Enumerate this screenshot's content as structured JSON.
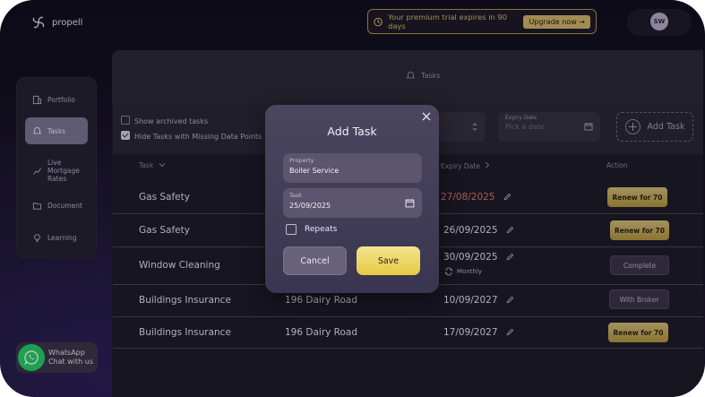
{
  "brand": {
    "name": "propell"
  },
  "trial": {
    "message": "Your premium trial expires in 90 days",
    "cta": "Upgrade now",
    "cta_arrow": "→"
  },
  "user": {
    "initials": "SW"
  },
  "sidebar": {
    "items": [
      {
        "label": "Portfolio",
        "icon": "portfolio-icon",
        "active": false
      },
      {
        "label": "Tasks",
        "icon": "tasks-icon",
        "active": true
      },
      {
        "label": "Live Mortgage Rates",
        "line1": "Live",
        "line2": "Mortgage",
        "line3": "Rates",
        "icon": "chart-icon",
        "active": false
      },
      {
        "label": "Document",
        "icon": "folder-icon",
        "active": false
      },
      {
        "label": "Learning",
        "icon": "lightbulb-icon",
        "active": false
      }
    ]
  },
  "page": {
    "title": "Tasks"
  },
  "filters": {
    "show_archived": "Show archived tasks",
    "hide_missing": "Hide Tasks with Missing Data Points",
    "expiry_label": "Expiry Date",
    "expiry_placeholder": "Pick a date",
    "add_task": "Add Task"
  },
  "table": {
    "headers": {
      "task": "Task",
      "expiry": "Expiry Date",
      "action": "Action"
    },
    "rows": [
      {
        "task": "Gas Safety",
        "property": "",
        "expiry": "27/08/2025",
        "overdue": true,
        "sub": "",
        "action": "Renew for 70",
        "action_style": "gold"
      },
      {
        "task": "Gas Safety",
        "property": "",
        "expiry": "26/09/2025",
        "overdue": false,
        "sub": "",
        "action": "Renew for 70",
        "action_style": "gold"
      },
      {
        "task": "Window Cleaning",
        "property": "",
        "expiry": "30/09/2025",
        "overdue": false,
        "sub": "Monthly",
        "action": "Complete",
        "action_style": "dark"
      },
      {
        "task": "Buildings Insurance",
        "property": "196 Dairy Road",
        "expiry": "10/09/2027",
        "overdue": false,
        "sub": "",
        "action": "With Broker",
        "action_style": "dark"
      },
      {
        "task": "Buildings Insurance",
        "property": "196 Dairy Road",
        "expiry": "17/09/2027",
        "overdue": false,
        "sub": "",
        "action": "Renew for 70",
        "action_style": "gold"
      }
    ]
  },
  "whatsapp": {
    "line1": "WhatsApp",
    "line2": "Chat with us"
  },
  "modal": {
    "title": "Add Task",
    "property_label": "Property",
    "property_value": "Boiler Service",
    "task_label": "Task",
    "task_value": "25/09/2025",
    "repeats_label": "Repeats",
    "cancel": "Cancel",
    "save": "Save"
  },
  "colors": {
    "accent_gold": "#d4b96a",
    "overdue_red": "#e07a6a",
    "save_yellow": "#efd765",
    "whatsapp_green": "#25d366"
  }
}
